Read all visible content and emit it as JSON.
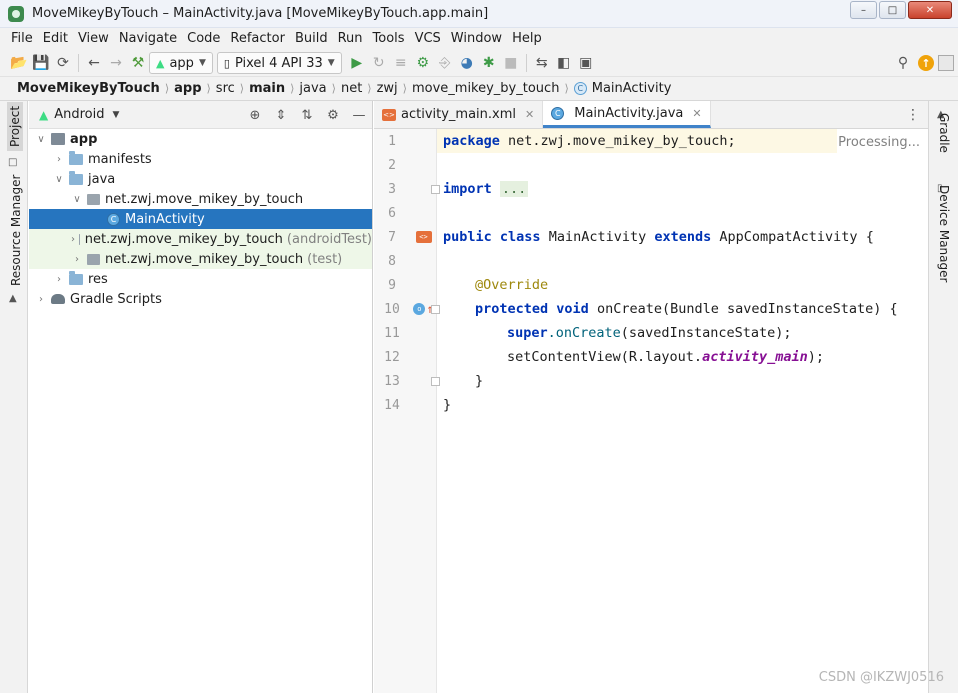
{
  "window": {
    "title": "MoveMikeyByTouch – MainActivity.java [MoveMikeyByTouch.app.main]",
    "controls": {
      "minimize": "–",
      "maximize": "□",
      "close": "✕"
    }
  },
  "menu": [
    "File",
    "Edit",
    "View",
    "Navigate",
    "Code",
    "Refactor",
    "Build",
    "Run",
    "Tools",
    "VCS",
    "Window",
    "Help"
  ],
  "toolbar": {
    "run_config": "app",
    "device": "Pixel 4 API 33"
  },
  "breadcrumb": [
    "MoveMikeyByTouch",
    "app",
    "src",
    "main",
    "java",
    "net",
    "zwj",
    "move_mikey_by_touch",
    "MainActivity"
  ],
  "side_tabs": {
    "left": [
      "Project",
      "Resource Manager"
    ],
    "right": [
      "Gradle",
      "Device Manager"
    ]
  },
  "project_panel": {
    "view": "Android",
    "tree": [
      {
        "label": "app"
      },
      {
        "label": "manifests"
      },
      {
        "label": "java"
      },
      {
        "label": "net.zwj.move_mikey_by_touch"
      },
      {
        "label": "MainActivity"
      },
      {
        "label": "net.zwj.move_mikey_by_touch",
        "suffix": "(androidTest)"
      },
      {
        "label": "net.zwj.move_mikey_by_touch",
        "suffix": "(test)"
      },
      {
        "label": "res"
      },
      {
        "label": "Gradle Scripts"
      }
    ]
  },
  "editor": {
    "tabs": [
      {
        "label": "activity_main.xml",
        "active": false
      },
      {
        "label": "MainActivity.java",
        "active": true
      }
    ],
    "status": "Processing...",
    "line_numbers": [
      "1",
      "2",
      "3",
      "6",
      "7",
      "8",
      "9",
      "10",
      "11",
      "12",
      "13",
      "14"
    ],
    "code": {
      "l1_kw": "package",
      "l1_rest": " net.zwj.move_mikey_by_touch;",
      "l3_kw": "import",
      "l3_dots": "...",
      "l7_kw1": "public",
      "l7_kw2": "class",
      "l7_name": " MainActivity ",
      "l7_kw3": "extends",
      "l7_rest": " AppCompatActivity {",
      "l9_anno": "@Override",
      "l10_kw1": "protected",
      "l10_kw2": "void",
      "l10_rest": " onCreate(Bundle savedInstanceState) {",
      "l11_kw": "super",
      "l11_call": ".onCreate",
      "l11_rest": "(savedInstanceState);",
      "l12_pre": "setContentView(R.layout.",
      "l12_field": "activity_main",
      "l12_post": ");",
      "l13": "}",
      "l14": "}"
    }
  },
  "watermark": "CSDN @IKZWJ0516"
}
